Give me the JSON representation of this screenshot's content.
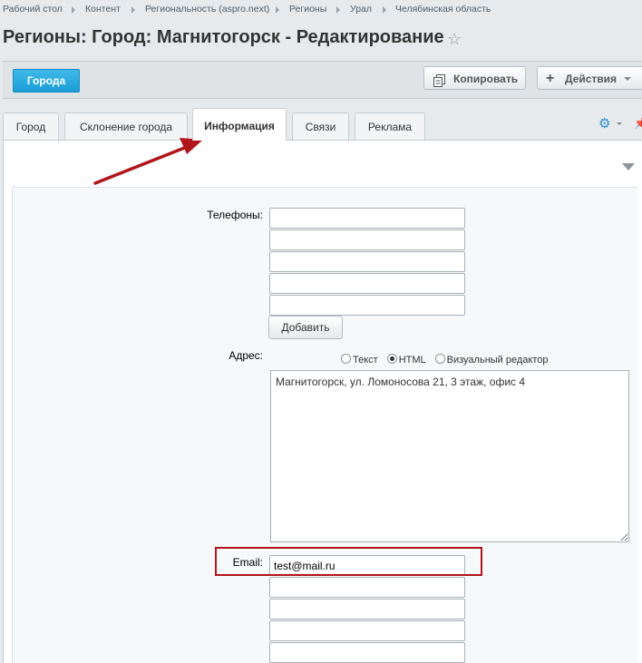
{
  "breadcrumb": [
    "Рабочий стол",
    "Контент",
    "Региональность (aspro.next)",
    "Регионы",
    "Урал",
    "Челябинская область"
  ],
  "page_title": "Регионы: Город: Магнитогорск - Редактирование",
  "toolbar": {
    "back_label": "Города",
    "copy_label": "Копировать",
    "actions_label": "Действия"
  },
  "tabs": [
    "Город",
    "Склонение города",
    "Информация",
    "Связи",
    "Реклама"
  ],
  "active_tab": "Информация",
  "form": {
    "phones_label": "Телефоны:",
    "phones": [
      "",
      "",
      "",
      "",
      ""
    ],
    "add_label": "Добавить",
    "address_label": "Адрес:",
    "editor_modes": [
      "Текст",
      "HTML",
      "Визуальный редактор"
    ],
    "editor_mode_selected": "HTML",
    "address_value": "Магнитогорск, ул. Ломоносова 21, 3 этаж, офис 4",
    "email_label": "Email:",
    "emails": [
      "test@mail.ru",
      "",
      "",
      "",
      ""
    ]
  },
  "colors": {
    "accent": "#1c9ed7",
    "highlight": "#b0151a"
  },
  "icons": [
    "star-icon",
    "copy-icon",
    "plus-icon",
    "gear-icon",
    "pin-icon",
    "collapse-icon",
    "arrow-annotation"
  ]
}
